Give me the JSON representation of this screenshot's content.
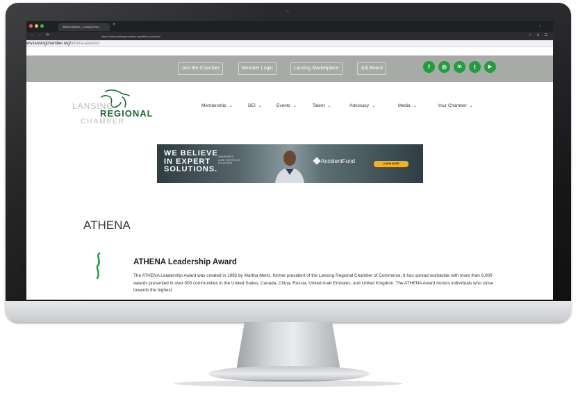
{
  "browser": {
    "tab_title": "Athena Award – Lansing Reg...",
    "new_tab": "+",
    "tab_list": "⌄",
    "nav_controls": [
      "←",
      "→",
      "⟳"
    ],
    "url_small": "https://www.lansingchamber.org/athena-awards/",
    "toolbar_icons": [
      "☆",
      "⬇",
      "☰"
    ],
    "url_display_domain": "ww.lansingchamber.org/",
    "url_display_path": "athena-awards/"
  },
  "topbar": {
    "links": [
      "Join the Chamber",
      "Member Login",
      "Lansing Marketplace",
      "Job Board"
    ],
    "social": [
      "f",
      "◎",
      "in",
      "t",
      "▶"
    ],
    "social_color": "#1f9e3b"
  },
  "logo": {
    "line1": "LANSING",
    "line2": "REGIONAL",
    "line3": "CHAMBER",
    "brand_color": "#1b6b2e"
  },
  "nav": {
    "items": [
      "Membership",
      "DEI",
      "Events",
      "Talent",
      "Advocacy",
      "Media",
      "Your Chamber"
    ],
    "chevron": "⌄"
  },
  "ad": {
    "headline_1": "WE BELIEVE",
    "headline_2": "IN EXPERT",
    "headline_3": "SOLUTIONS.",
    "sub_1": "AWARENESS",
    "sub_2": "LOOK FOR STOCK",
    "sub_3": "SOLUTIONS",
    "brand": "AccidentFund",
    "cta": "LEARN MORE"
  },
  "main": {
    "page_title": "ATHENA",
    "award_title": "ATHENA Leadership Award",
    "award_body": "The ATHENA Leadership Award was created in 1982 by Martha Mertz, former president of the Lansing Regional Chamber of Commerce. It has spread worldwide with more than 6,000 awards presented in over 500 communities in the United States, Canada, China, Russia, United Arab Emirates, and United Kingdom. The ATHENA Award honors individuals who strive towards the highest"
  }
}
